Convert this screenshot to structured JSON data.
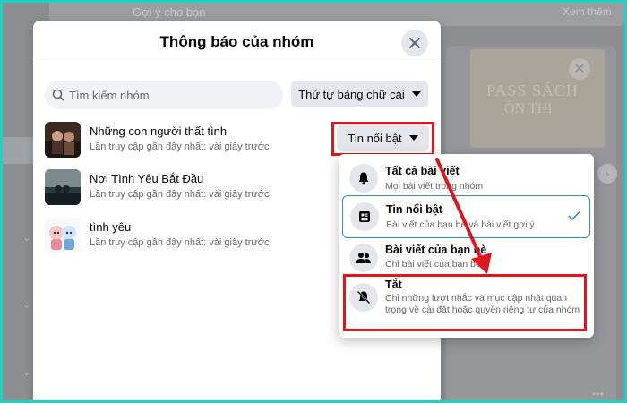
{
  "background": {
    "suggest_label": "Gợi ý cho bạn",
    "see_all_label": "Xem thêm",
    "image_text_1": "PASS SÁCH",
    "image_text_2": "ÔN THI"
  },
  "modal": {
    "title": "Thông báo của nhóm",
    "search_placeholder": "Tìm kiếm nhóm",
    "sort_label": "Thứ tự bảng chữ cái",
    "groups": [
      {
        "name": "Những con người thất tình",
        "last_visit": "Lần truy cập gần đây nhất: vài giây trước"
      },
      {
        "name": "Nơi Tình Yêu Bắt Đầu",
        "last_visit": "Lần truy cập gần đây nhất: vài giây trước"
      },
      {
        "name": "tình yêu",
        "last_visit": "Lần truy cập gần đây nhất: vài giây trước"
      }
    ],
    "notification_setting_label": "Tin nổi bật"
  },
  "menu": {
    "items": [
      {
        "title": "Tất cả bài viết",
        "desc": "Mọi bài viết trong nhóm",
        "icon": "bell-icon",
        "selected": false
      },
      {
        "title": "Tin nổi bật",
        "desc": "Bài viết của bạn bè và bài viết gợi ý",
        "icon": "news-feed-icon",
        "selected": true
      },
      {
        "title": "Bài viết của bạn bè",
        "desc": "Chỉ bài viết của bạn bè",
        "icon": "friends-icon",
        "selected": false
      },
      {
        "title": "Tắt",
        "desc": "Chỉ những lượt nhắc và mục cập nhật quan trọng về cài đặt hoặc quyền riêng tư của nhóm",
        "icon": "bell-off-icon",
        "selected": false
      }
    ]
  },
  "colors": {
    "highlight": "#e0161f",
    "accent": "#2d88ff",
    "frame": "#1bd3c0"
  }
}
